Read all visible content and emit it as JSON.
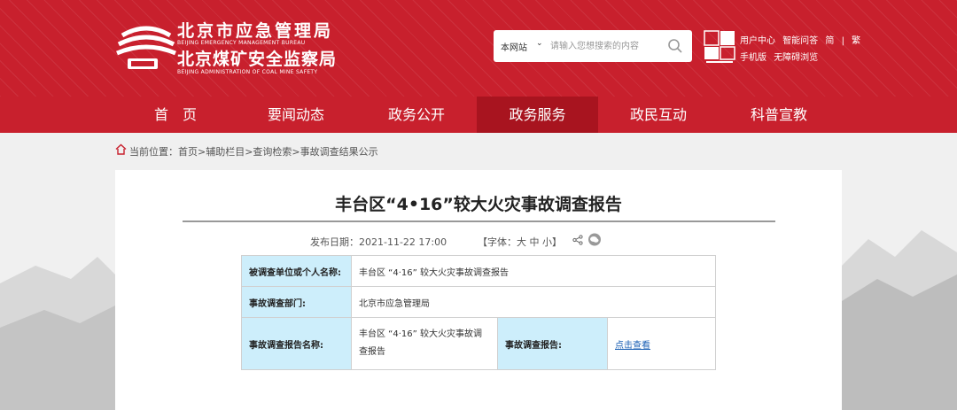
{
  "header": {
    "logo_cn_1": "北京市应急管理局",
    "logo_en_1": "BEIJING EMERGENCY MANAGEMENT BUREAU",
    "logo_cn_2": "北京煤矿安全监察局",
    "logo_en_2": "BEIJING ADMINISTRATION OF COAL MINE SAFETY",
    "search_scope": "本网站",
    "search_placeholder": "请输入您想搜索的内容",
    "links_row1": [
      "用户中心",
      "智能问答",
      "简",
      "|",
      "繁"
    ],
    "links_row2": [
      "手机版",
      "无障碍浏览"
    ]
  },
  "nav": {
    "items": [
      "首　页",
      "要闻动态",
      "政务公开",
      "政务服务",
      "政民互动",
      "科普宣教"
    ],
    "active_index": 3
  },
  "breadcrumb": {
    "label": "当前位置：",
    "path": "首页>辅助栏目>查询检索>事故调查结果公示"
  },
  "article": {
    "title": "丰台区“4•16”较大火灾事故调查报告",
    "publish_date": "发布日期：2021-11-22 17:00",
    "font_size_control": "【字体：大 中 小】"
  },
  "table": {
    "row1_label": "被调查单位或个人名称:",
    "row1_value": "丰台区 “4·16” 较大火灾事故调查报告",
    "row2_label": "事故调查部门:",
    "row2_value": "北京市应急管理局",
    "row3_label": "事故调查报告名称:",
    "row3_value": "丰台区 “4·16” 较大火灾事故调查报告",
    "row3_label2": "事故调查报告:",
    "row3_link": "点击查看"
  },
  "colors": {
    "brand_red": "#c8202d",
    "nav_active": "#a8141f",
    "table_label_bg": "#cdeefb",
    "link": "#1a5fb4"
  }
}
